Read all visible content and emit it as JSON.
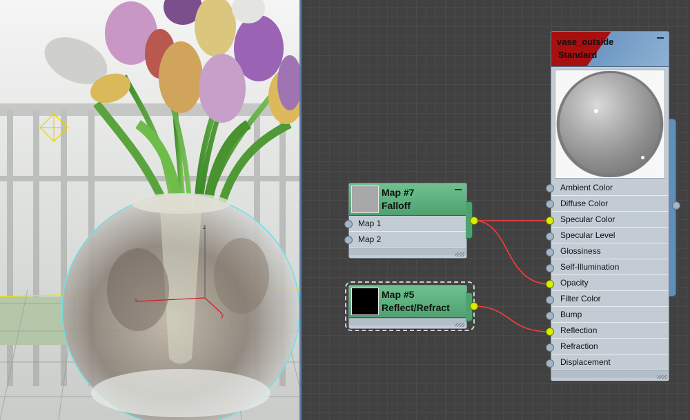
{
  "viewport": {
    "axis_label": "z",
    "gizmo_x_label": "x",
    "gizmo_y_label": "y"
  },
  "nodes": {
    "falloff": {
      "title_line1": "Map #7",
      "title_line2": "Falloff",
      "inputs": [
        "Map 1",
        "Map 2"
      ]
    },
    "reflect": {
      "title_line1": "Map #5",
      "title_line2": "Reflect/Refract"
    },
    "material": {
      "title_line1": "vase_outside",
      "title_line2": "Standard",
      "inputs": [
        "Ambient Color",
        "Diffuse Color",
        "Specular Color",
        "Specular Level",
        "Glossiness",
        "Self-Illumination",
        "Opacity",
        "Filter Color",
        "Bump",
        "Reflection",
        "Refraction",
        "Displacement"
      ],
      "connected_inputs": [
        "Specular Color",
        "Opacity",
        "Reflection"
      ]
    }
  },
  "colors": {
    "wire": "#ff3b3b",
    "map_node": "#4ea26f",
    "material_header_red": "#a80f0f",
    "material_header_blue": "#8fb2d4",
    "active_slot": "#d8f000",
    "canvas_bg": "#414141"
  }
}
